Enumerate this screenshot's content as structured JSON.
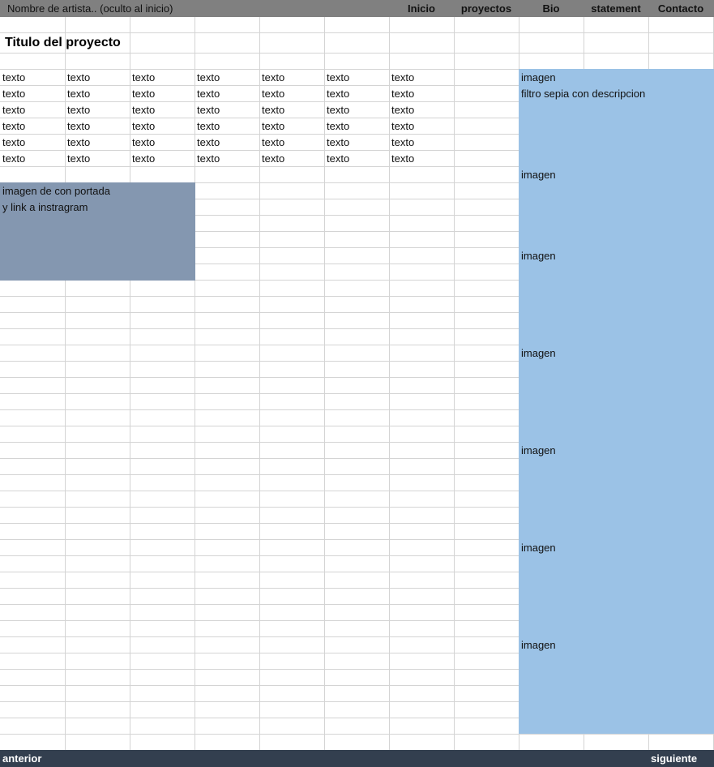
{
  "header": {
    "artist_name": "Nombre de artista.. (oculto al inicio)",
    "nav": [
      "Inicio",
      "proyectos",
      "Bio",
      "statement",
      "Contacto"
    ]
  },
  "title": "Titulo del proyecto",
  "text_grid": {
    "cell": "texto",
    "rows": 6,
    "cols": 7
  },
  "gallery": {
    "first_label": "imagen",
    "description": "filtro sepia con descripcion",
    "images": [
      "imagen",
      "imagen",
      "imagen",
      "imagen",
      "imagen",
      "imagen"
    ]
  },
  "cover": {
    "line1": "imagen de con portada",
    "line2": "y link a instragram"
  },
  "footer": {
    "prev": "anterior",
    "next": "siguiente"
  },
  "colors": {
    "header": "#808080",
    "footer": "#333f4f",
    "gallery": "#9bc2e6",
    "cover": "#8497b0"
  }
}
